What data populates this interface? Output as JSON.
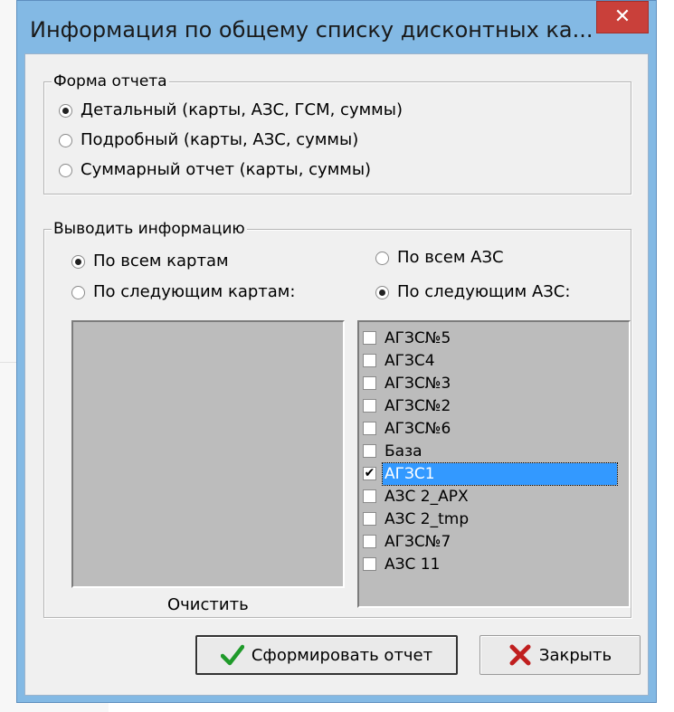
{
  "window": {
    "title": "Информация по общему списку дисконтных ка...",
    "close_glyph": "✕"
  },
  "report_form": {
    "legend": "Форма отчета",
    "options": [
      {
        "label": "Детальный (карты, АЗС, ГСМ, суммы)",
        "checked": true
      },
      {
        "label": "Подробный (карты, АЗС, суммы)",
        "checked": false
      },
      {
        "label": "Суммарный отчет (карты, суммы)",
        "checked": false
      }
    ]
  },
  "output_info": {
    "legend": "Выводить информацию",
    "cards_options": [
      {
        "label": "По всем картам",
        "checked": true
      },
      {
        "label": "По следующим картам:",
        "checked": false
      }
    ],
    "stations_options": [
      {
        "label": "По всем АЗС",
        "checked": false
      },
      {
        "label": "По следующим АЗС:",
        "checked": true
      }
    ],
    "clear_label": "Очистить",
    "stations": [
      {
        "label": "АГЗС№5",
        "checked": false,
        "selected": false
      },
      {
        "label": "АГЗС4",
        "checked": false,
        "selected": false
      },
      {
        "label": "АГЗС№3",
        "checked": false,
        "selected": false
      },
      {
        "label": "АГЗС№2",
        "checked": false,
        "selected": false
      },
      {
        "label": "АГЗС№6",
        "checked": false,
        "selected": false
      },
      {
        "label": "База",
        "checked": false,
        "selected": false
      },
      {
        "label": "АГЗС1",
        "checked": true,
        "selected": true
      },
      {
        "label": "АЗС 2_АРХ",
        "checked": false,
        "selected": false
      },
      {
        "label": "АЗС 2_tmp",
        "checked": false,
        "selected": false
      },
      {
        "label": "АГЗС№7",
        "checked": false,
        "selected": false
      },
      {
        "label": "АЗС 11",
        "checked": false,
        "selected": false
      }
    ]
  },
  "buttons": {
    "generate_label": "Сформировать отчет",
    "close_label": "Закрыть"
  },
  "colors": {
    "window_frame": "#83b9e4",
    "close_button": "#c9403a",
    "selection": "#3399ff"
  }
}
